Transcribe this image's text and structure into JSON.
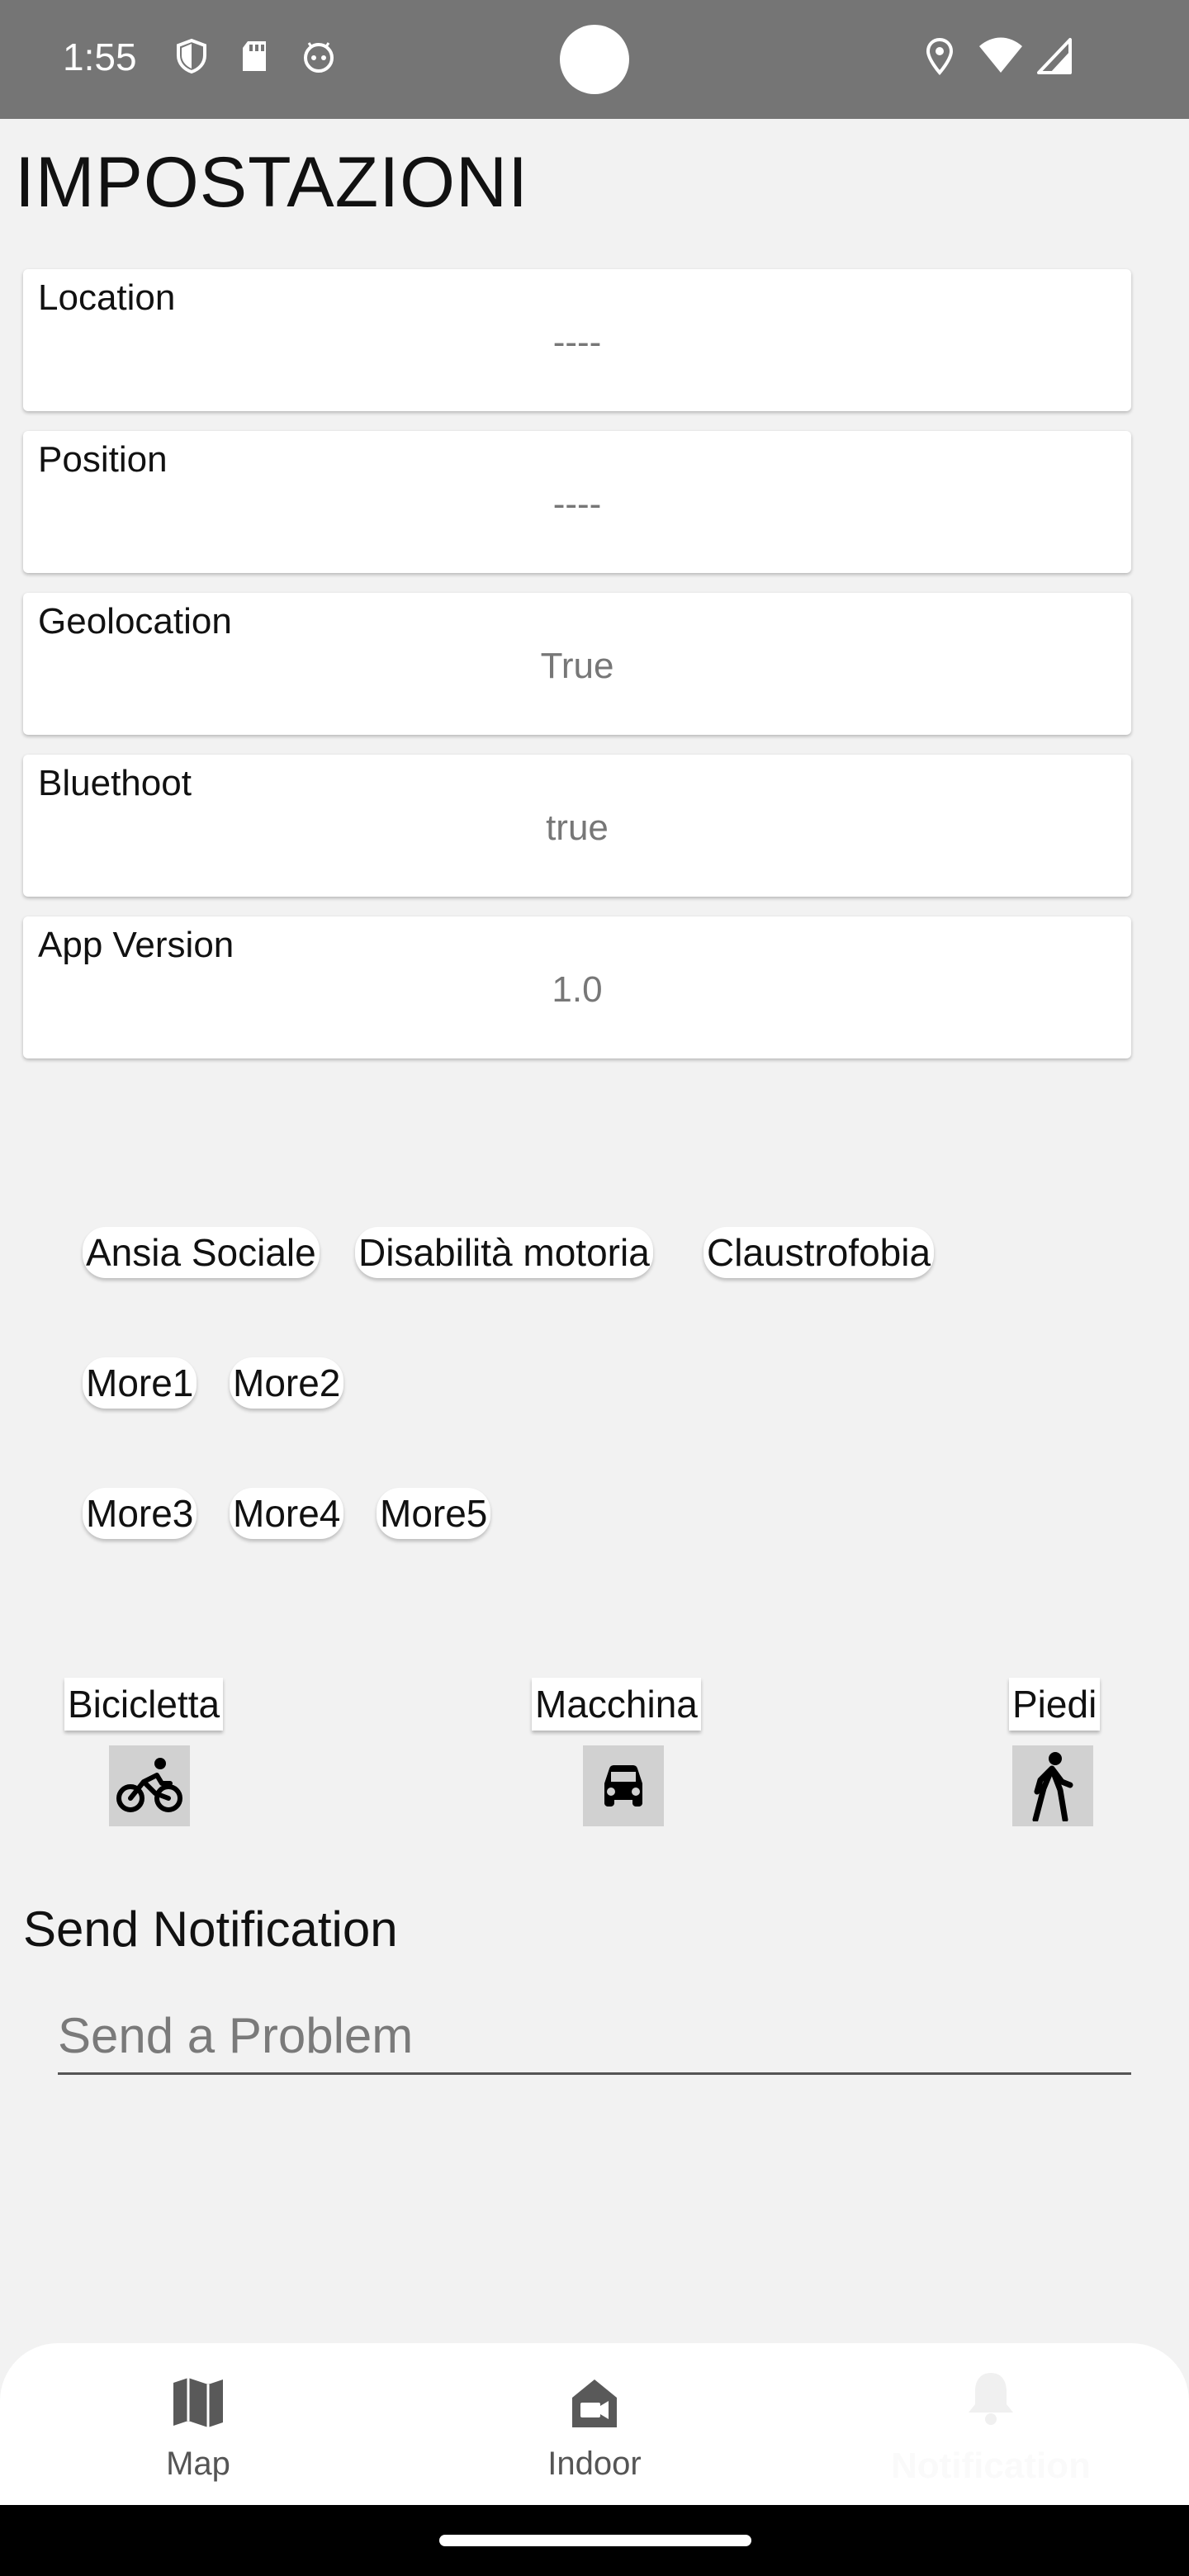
{
  "status_bar": {
    "time": "1:55",
    "left_icons": [
      "shield-icon",
      "sd-card-icon",
      "android-face-icon"
    ],
    "right_icons": [
      "location-pin-icon",
      "wifi-icon",
      "cell-signal-icon"
    ]
  },
  "page": {
    "title": "IMPOSTAZIONI"
  },
  "settings": [
    {
      "label": "Location",
      "value": "----"
    },
    {
      "label": "Position",
      "value": "----"
    },
    {
      "label": "Geolocation",
      "value": "True"
    },
    {
      "label": "Bluethoot",
      "value": "true"
    },
    {
      "label": "App Version",
      "value": "1.0"
    }
  ],
  "conditions": {
    "row1": [
      "Ansia Sociale",
      "Disabilità motoria",
      "Claustrofobia"
    ],
    "row2": [
      "More1",
      "More2"
    ],
    "row3": [
      "More3",
      "More4",
      "More5"
    ]
  },
  "transport": [
    {
      "label": "Bicicletta",
      "icon": "bicycle-icon"
    },
    {
      "label": "Macchina",
      "icon": "car-icon"
    },
    {
      "label": "Piedi",
      "icon": "walking-icon"
    }
  ],
  "notification": {
    "section_title": "Send Notification",
    "input_placeholder": "Send a Problem",
    "input_value": ""
  },
  "bottom_nav": [
    {
      "label": "Map",
      "icon": "map-icon",
      "active": false
    },
    {
      "label": "Indoor",
      "icon": "indoor-camera-icon",
      "active": false
    },
    {
      "label": "Notification",
      "icon": "bell-icon",
      "active": true
    }
  ],
  "colors": {
    "status_bar": "#757575",
    "background": "#f2f2f2",
    "card": "#ffffff",
    "icon_tile": "#d1d1d1",
    "nav_label": "#555555",
    "nav_active_label": "#fafafa"
  }
}
